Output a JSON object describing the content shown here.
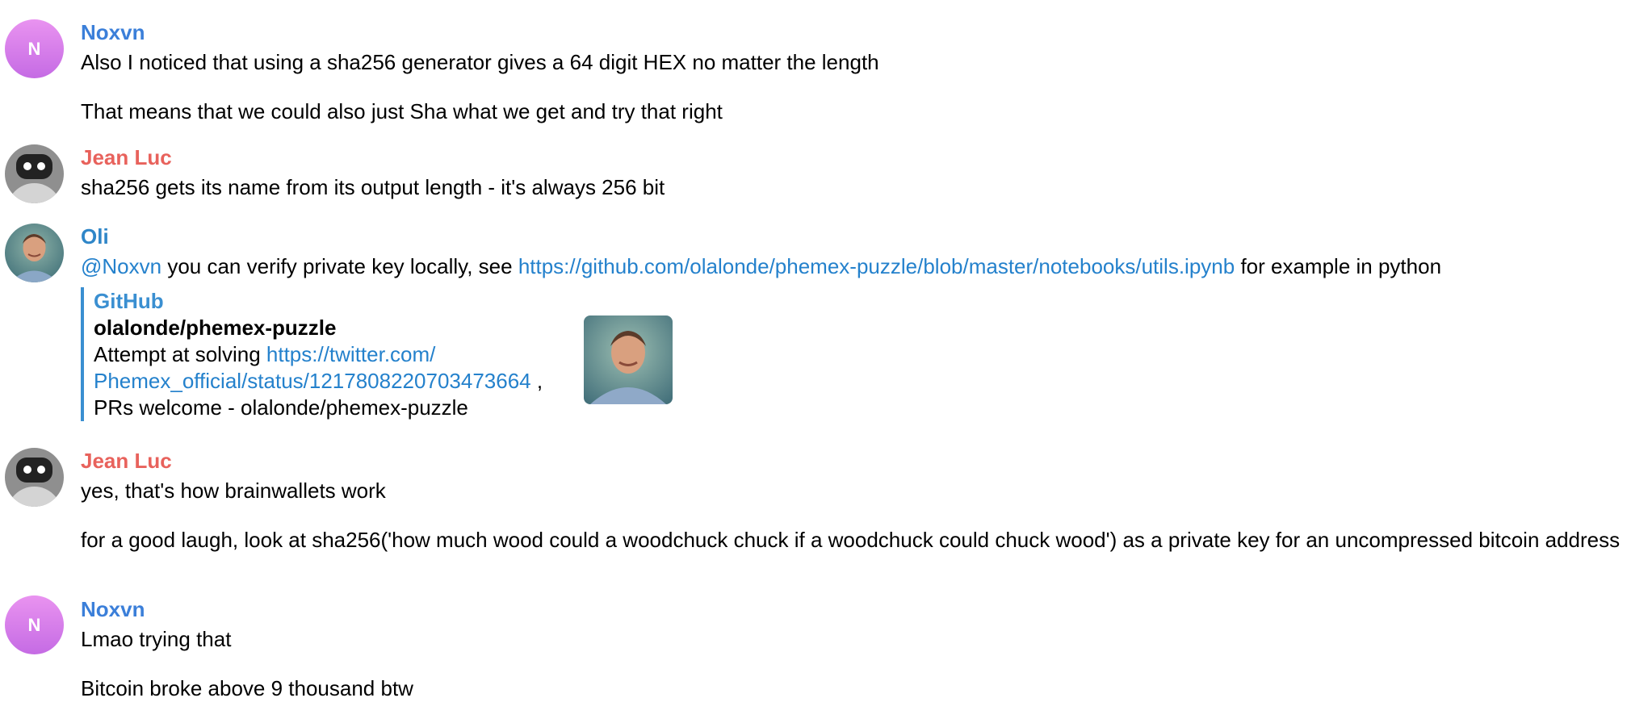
{
  "colors": {
    "noxvn_name": "#3b7fd9",
    "jeanluc_name": "#e8625c",
    "oli_name": "#2f86c8",
    "link": "#2481cc",
    "preview_bar": "#3a8fd1"
  },
  "messages": [
    {
      "sender": "Noxvn",
      "avatar_initial": "N",
      "lines": [
        "Also I noticed that using a sha256 generator gives a 64 digit HEX no matter the length",
        "That means that we could also just Sha what we get and try that right"
      ]
    },
    {
      "sender": "Jean Luc",
      "avatar_icon": "robot-icon",
      "lines": [
        "sha256 gets its name from its output length - it's always 256 bit"
      ]
    },
    {
      "sender": "Oli",
      "avatar_icon": "user-photo",
      "mention": "@Noxvn",
      "text_before_link": " you can verify private key locally, see ",
      "link": "https://github.com/olalonde/phemex-puzzle/blob/master/notebooks/utils.ipynb",
      "text_after_link": " for example in python",
      "preview": {
        "site": "GitHub",
        "title": "olalonde/phemex-puzzle",
        "desc_prefix": "Attempt at solving ",
        "desc_link_line1": "https://twitter.com/",
        "desc_link_line2": "Phemex_official/status/1217808220703473664",
        "desc_after_link": " ,",
        "desc_line3": "PRs welcome - olalonde/phemex-puzzle"
      }
    },
    {
      "sender": "Jean Luc",
      "avatar_icon": "robot-icon",
      "lines": [
        "yes, that's how brainwallets work",
        "for a good laugh, look at sha256('how much wood could a woodchuck chuck if a woodchuck could chuck wood') as a private key for an uncompressed bitcoin address"
      ]
    },
    {
      "sender": "Noxvn",
      "avatar_initial": "N",
      "lines": [
        "Lmao trying that",
        "Bitcoin broke above 9 thousand btw"
      ]
    }
  ]
}
